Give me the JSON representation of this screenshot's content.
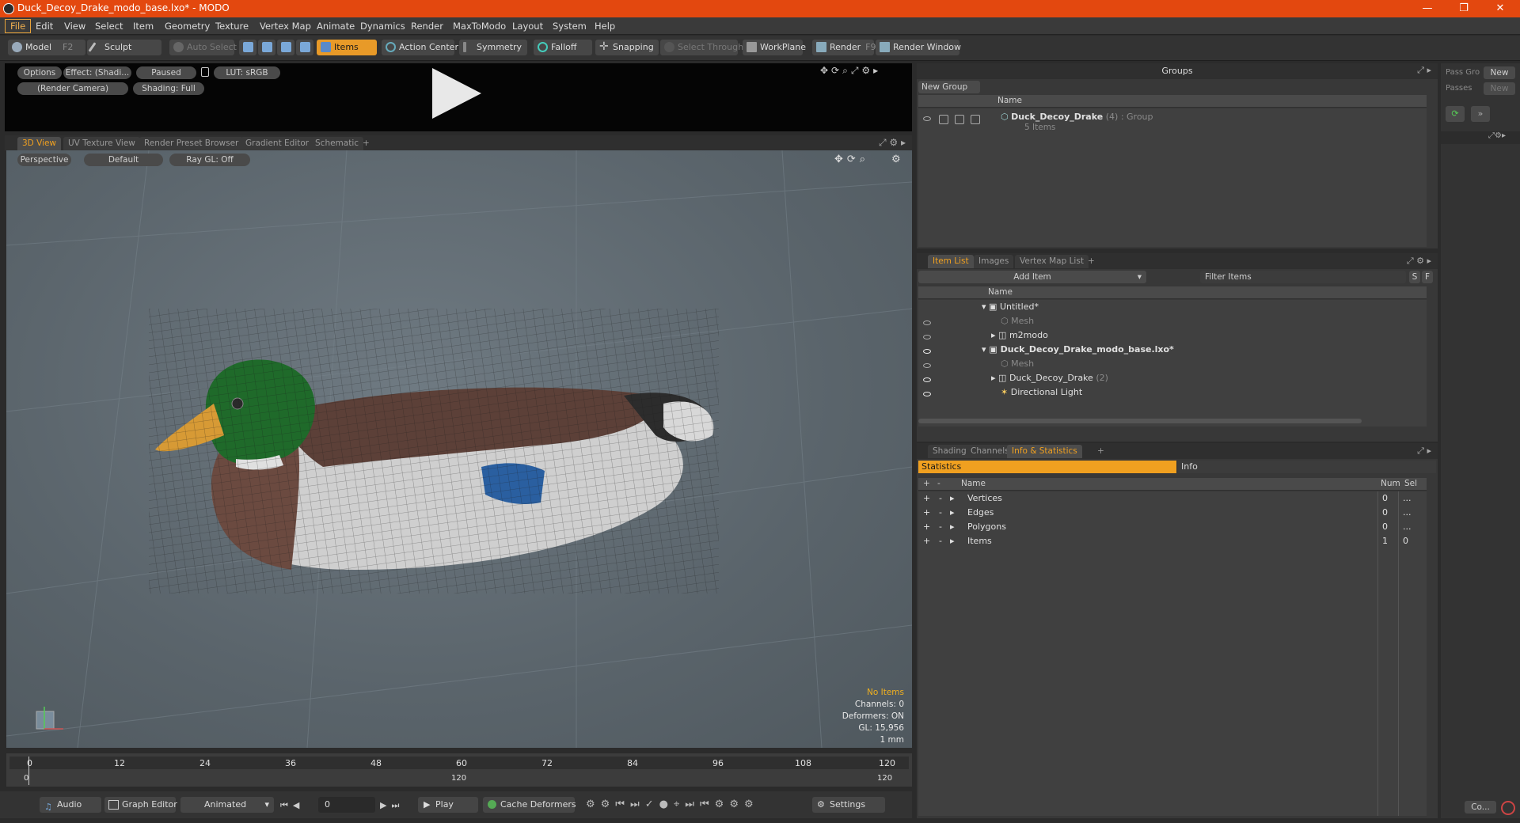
{
  "window": {
    "title": "Duck_Decoy_Drake_modo_base.lxo* - MODO",
    "minimize": "—",
    "maximize": "❐",
    "close": "✕"
  },
  "menu": [
    "File",
    "Edit",
    "View",
    "Select",
    "Item",
    "Geometry",
    "Texture",
    "Vertex Map",
    "Animate",
    "Dynamics",
    "Render",
    "MaxToModo",
    "Layout",
    "System",
    "Help"
  ],
  "toolbar": {
    "model": "Model",
    "model_key": "F2",
    "sculpt": "Sculpt",
    "auto_select": "Auto Select",
    "items": "Items",
    "action_center": "Action Center",
    "symmetry": "Symmetry",
    "falloff": "Falloff",
    "snapping": "Snapping",
    "select_through": "Select Through",
    "workplane": "WorkPlane",
    "render": "Render",
    "render_key": "F9",
    "render_window": "Render Window"
  },
  "preview": {
    "options": "Options",
    "effect": "Effect: (Shadi...",
    "paused": "Paused",
    "lut": "LUT: sRGB",
    "camera": "(Render Camera)",
    "shading": "Shading: Full"
  },
  "viewport_tabs": [
    "3D View",
    "UV Texture View",
    "Render Preset Browser",
    "Gradient Editor",
    "Schematic",
    "+"
  ],
  "viewport": {
    "perspective": "Perspective",
    "default": "Default",
    "raygl": "Ray GL: Off",
    "info": {
      "no_items": "No Items",
      "channels": "Channels: 0",
      "deformers": "Deformers: ON",
      "gl": "GL: 15,956",
      "unit": "1 mm"
    }
  },
  "timeline": {
    "ticks": [
      "0",
      "12",
      "24",
      "36",
      "48",
      "60",
      "72",
      "84",
      "96",
      "108",
      "120"
    ],
    "start": "0",
    "mid": "120",
    "end": "120"
  },
  "bottom": {
    "audio": "Audio",
    "graph_editor": "Graph Editor",
    "animated": "Animated",
    "frame": "0",
    "play": "Play",
    "cache": "Cache Deformers",
    "settings": "Settings"
  },
  "groups": {
    "title": "Groups",
    "new_group": "New Group",
    "col_name": "Name",
    "item_name": "Duck_Decoy_Drake",
    "item_count": "(4)",
    "item_type": ": Group",
    "item_sub": "5 Items"
  },
  "pass": {
    "pass_gro": "Pass Gro",
    "new1": "New",
    "passes": "Passes",
    "new2": "New",
    "co": "Co..."
  },
  "itemlist": {
    "tabs": [
      "Item List",
      "Images",
      "Vertex Map List",
      "+"
    ],
    "add_item": "Add Item",
    "filter": "Filter Items",
    "s": "S",
    "f": "F",
    "col_name": "Name",
    "rows": [
      {
        "label": "Untitled*",
        "note": ""
      },
      {
        "label": "Mesh",
        "note": ""
      },
      {
        "label": "m2modo",
        "note": ""
      },
      {
        "label": "Duck_Decoy_Drake_modo_base.lxo*",
        "note": ""
      },
      {
        "label": "Mesh",
        "note": ""
      },
      {
        "label": "Duck_Decoy_Drake",
        "note": "(2)"
      },
      {
        "label": "Directional Light",
        "note": ""
      }
    ]
  },
  "stats": {
    "tabs": [
      "Shading",
      "Channels",
      "Info & Statistics",
      "+"
    ],
    "statistics": "Statistics",
    "info": "Info",
    "col_name": "Name",
    "col_num": "Num",
    "col_sel": "Sel",
    "rows": [
      {
        "name": "Vertices",
        "num": "0",
        "sel": "..."
      },
      {
        "name": "Edges",
        "num": "0",
        "sel": "..."
      },
      {
        "name": "Polygons",
        "num": "0",
        "sel": "..."
      },
      {
        "name": "Items",
        "num": "1",
        "sel": "0"
      }
    ]
  },
  "colors": {
    "accent": "#f0a020",
    "titlebar": "#e3480f"
  }
}
